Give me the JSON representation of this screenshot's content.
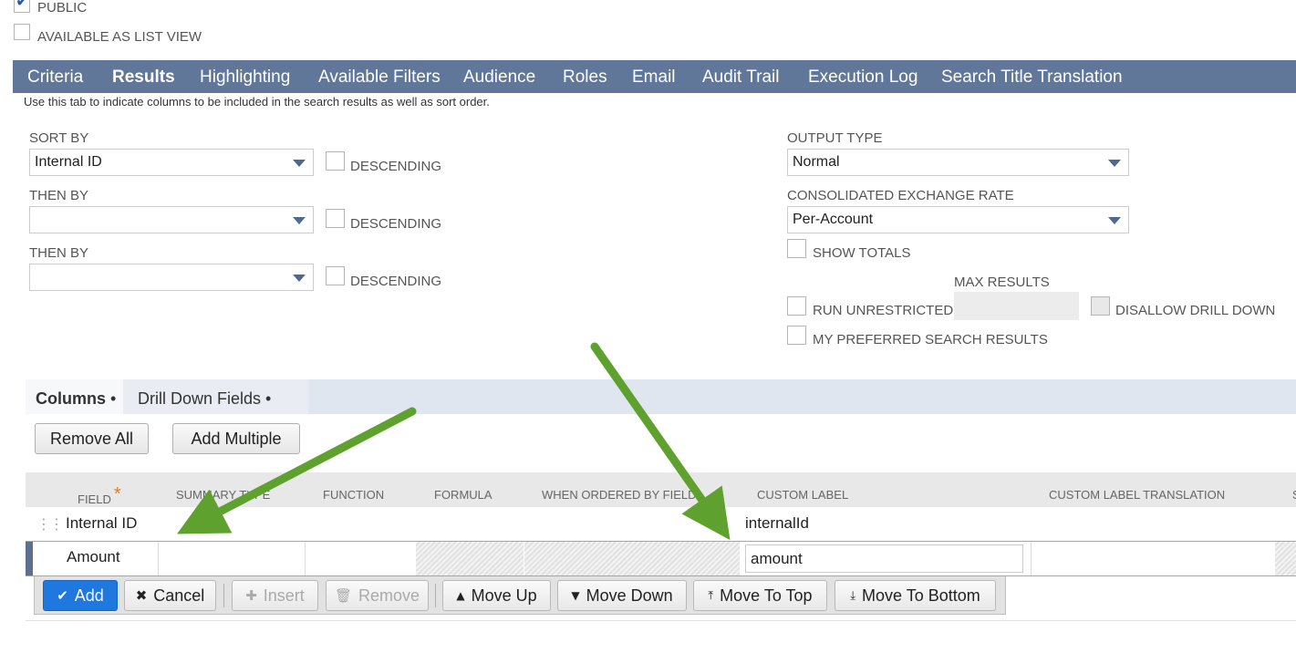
{
  "top_checkboxes": {
    "public_label": "PUBLIC",
    "public_checked": true,
    "list_view_label": "AVAILABLE AS LIST VIEW",
    "list_view_checked": false
  },
  "tabs": [
    {
      "label": "Criteria",
      "active": false
    },
    {
      "label": "Results",
      "active": true
    },
    {
      "label": "Highlighting",
      "active": false
    },
    {
      "label": "Available Filters",
      "active": false
    },
    {
      "label": "Audience",
      "active": false
    },
    {
      "label": "Roles",
      "active": false
    },
    {
      "label": "Email",
      "active": false
    },
    {
      "label": "Audit Trail",
      "active": false
    },
    {
      "label": "Execution Log",
      "active": false
    },
    {
      "label": "Search Title Translation",
      "active": false
    }
  ],
  "help_text": "Use this tab to indicate columns to be included in the search results as well as sort order.",
  "sort": {
    "sort_by_label": "SORT BY",
    "sort_by_value": "Internal ID",
    "then_by_1_label": "THEN BY",
    "then_by_1_value": "",
    "then_by_2_label": "THEN BY",
    "then_by_2_value": "",
    "descending_label": "DESCENDING"
  },
  "output": {
    "output_type_label": "OUTPUT TYPE",
    "output_type_value": "Normal",
    "exchange_rate_label": "CONSOLIDATED EXCHANGE RATE",
    "exchange_rate_value": "Per-Account",
    "show_totals_label": "SHOW TOTALS",
    "max_results_label": "MAX RESULTS",
    "max_results_value": "",
    "run_unrestricted_label": "RUN UNRESTRICTED",
    "disallow_drill_down_label": "DISALLOW DRILL DOWN",
    "preferred_results_label": "MY PREFERRED SEARCH RESULTS"
  },
  "subtabs": [
    {
      "label": "Columns",
      "dot": "•",
      "active": true
    },
    {
      "label": "Drill Down Fields",
      "dot": "•",
      "active": false
    }
  ],
  "actions": {
    "remove_all": "Remove All",
    "add_multiple": "Add Multiple"
  },
  "columns_header": {
    "field": "FIELD",
    "required_mark": "*",
    "summary_type": "SUMMARY TYPE",
    "function": "FUNCTION",
    "formula": "FORMULA",
    "when_ordered_by": "WHEN ORDERED BY FIELD",
    "custom_label": "CUSTOM LABEL",
    "custom_label_translation": "CUSTOM LABEL TRANSLATION",
    "truncated_next": "S"
  },
  "rows": [
    {
      "field": "Internal ID",
      "custom_label": "internalId"
    },
    {
      "field": "Amount",
      "custom_label": "amount"
    }
  ],
  "row_toolbar": {
    "add": "Add",
    "cancel": "Cancel",
    "insert": "Insert",
    "remove": "Remove",
    "move_up": "Move Up",
    "move_down": "Move Down",
    "move_to_top": "Move To Top",
    "move_to_bottom": "Move To Bottom"
  },
  "colors": {
    "tab_bar": "#607799",
    "primary_button": "#1f77e0",
    "annotation_arrow": "#5fa12e",
    "required_star": "#e07a1f"
  },
  "icons": {
    "check": "check-icon",
    "drag": "drag-handle-icon",
    "dropdown": "dropdown-caret-icon"
  }
}
